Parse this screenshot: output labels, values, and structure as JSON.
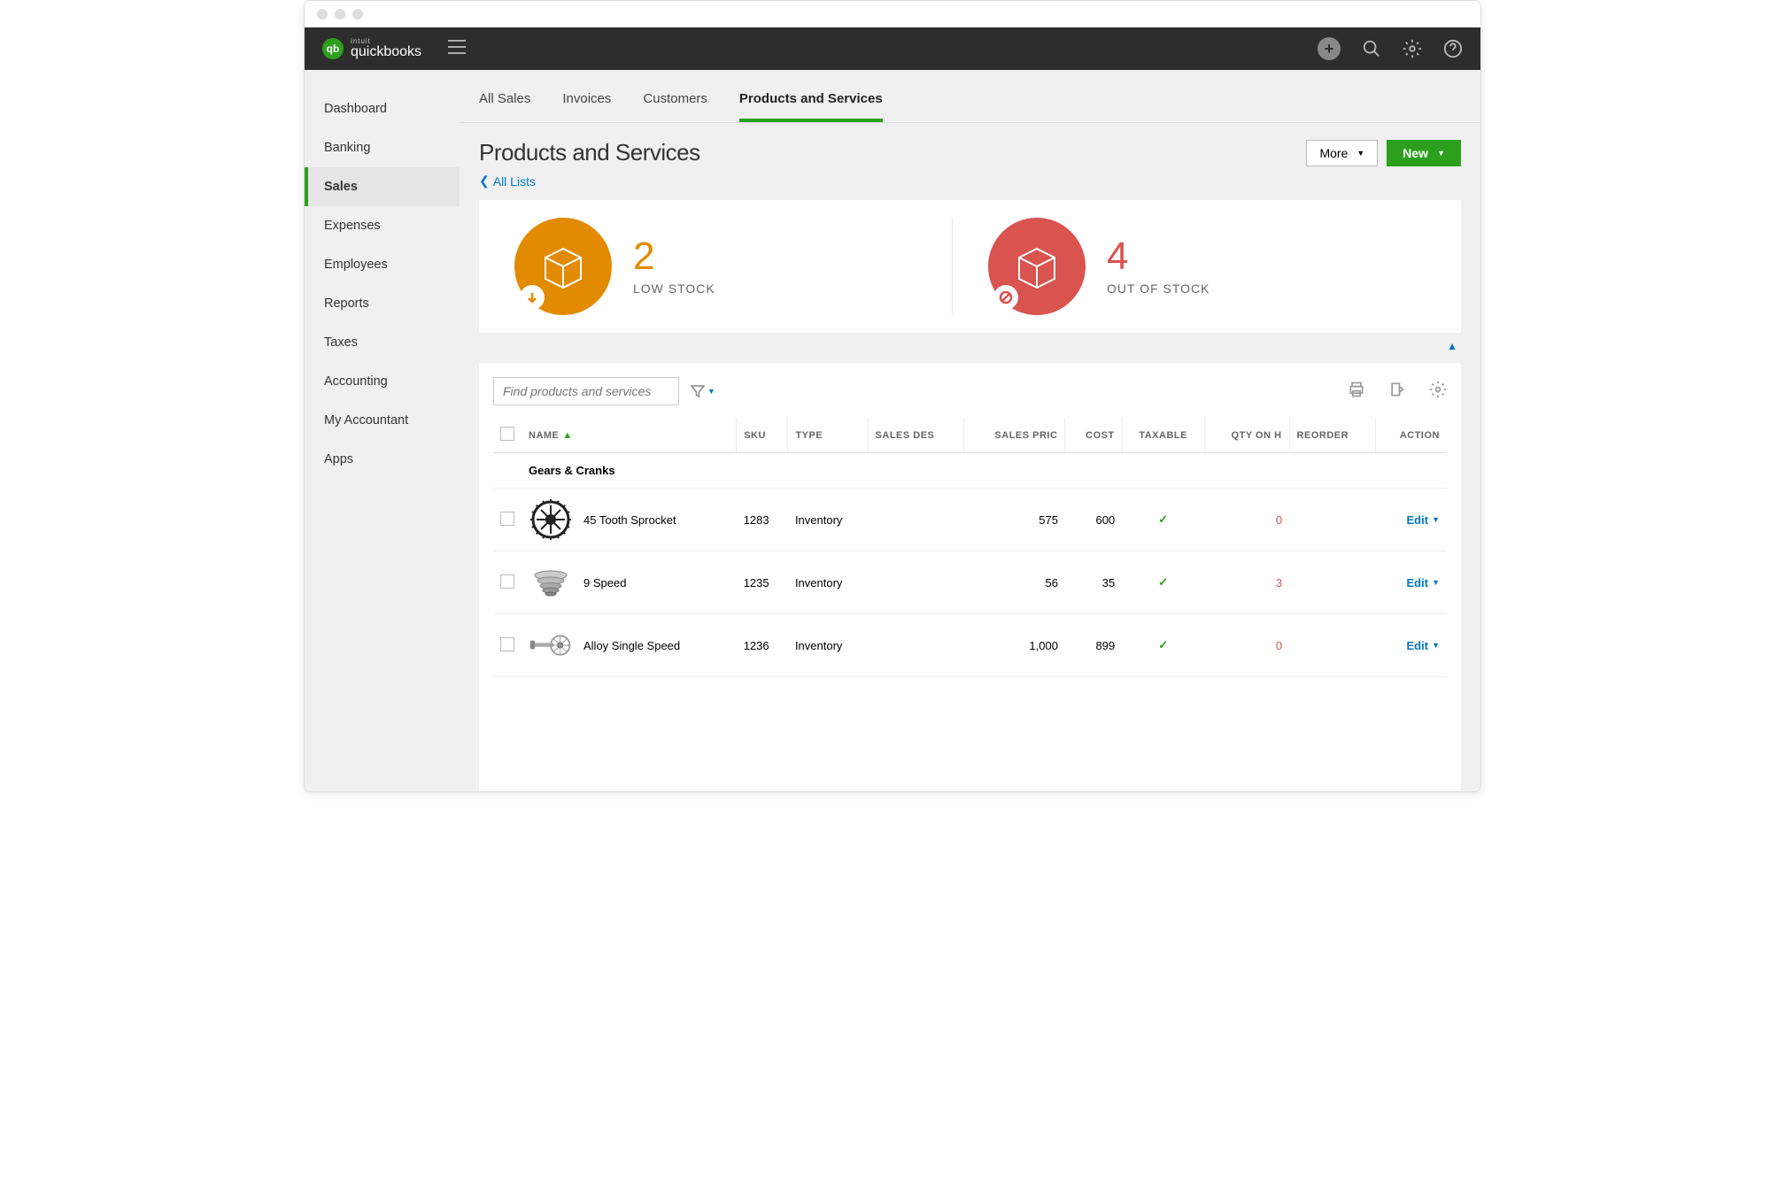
{
  "brand": {
    "intuit": "intuit",
    "product": "quickbooks"
  },
  "sidebar": {
    "items": [
      {
        "label": "Dashboard"
      },
      {
        "label": "Banking"
      },
      {
        "label": "Sales",
        "active": true
      },
      {
        "label": "Expenses"
      },
      {
        "label": "Employees"
      },
      {
        "label": "Reports"
      },
      {
        "label": "Taxes"
      },
      {
        "label": "Accounting"
      },
      {
        "label": "My Accountant"
      },
      {
        "label": "Apps"
      }
    ]
  },
  "tabs": [
    {
      "label": "All Sales"
    },
    {
      "label": "Invoices"
    },
    {
      "label": "Customers"
    },
    {
      "label": "Products and Services",
      "active": true
    }
  ],
  "page": {
    "title": "Products and Services",
    "back_link": "All Lists",
    "more_label": "More",
    "new_label": "New"
  },
  "stats": {
    "low_stock": {
      "value": "2",
      "label": "LOW STOCK"
    },
    "out_of_stock": {
      "value": "4",
      "label": "OUT OF STOCK"
    }
  },
  "search": {
    "placeholder": "Find products and services"
  },
  "columns": {
    "name": "NAME",
    "sku": "SKU",
    "type": "TYPE",
    "sales_desc": "SALES DES",
    "sales_price": "SALES PRIC",
    "cost": "COST",
    "taxable": "TAXABLE",
    "qty": "QTY ON H",
    "reorder": "REORDER",
    "action": "ACTION"
  },
  "category": {
    "name": "Gears & Cranks"
  },
  "rows": [
    {
      "name": "45 Tooth Sprocket",
      "sku": "1283",
      "type": "Inventory",
      "sales_price": "575",
      "cost": "600",
      "taxable": true,
      "qty": "0",
      "qty_low": true,
      "action": "Edit"
    },
    {
      "name": "9 Speed",
      "sku": "1235",
      "type": "Inventory",
      "sales_price": "56",
      "cost": "35",
      "taxable": true,
      "qty": "3",
      "qty_low": true,
      "action": "Edit"
    },
    {
      "name": "Alloy Single Speed",
      "sku": "1236",
      "type": "Inventory",
      "sales_price": "1,000",
      "cost": "899",
      "taxable": true,
      "qty": "0",
      "qty_low": true,
      "action": "Edit"
    }
  ]
}
